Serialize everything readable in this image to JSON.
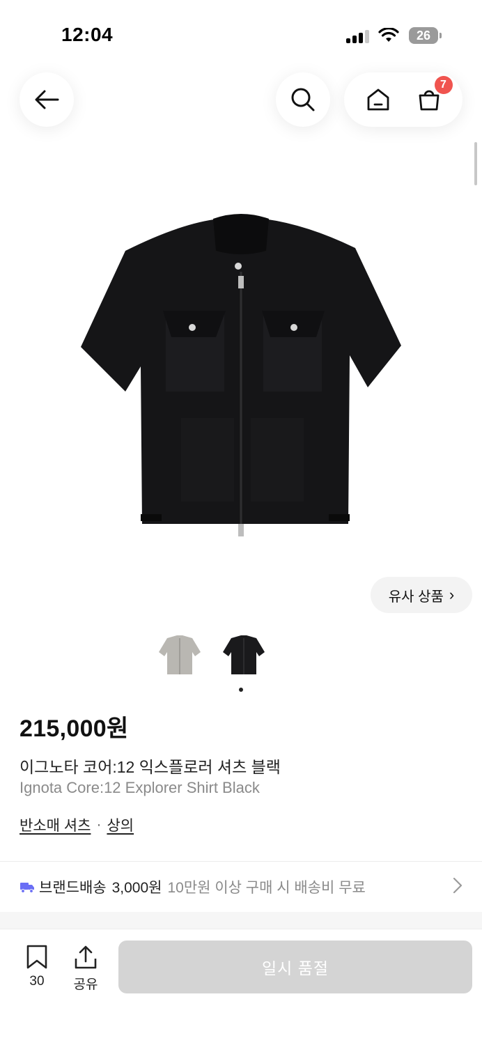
{
  "status_bar": {
    "time": "12:04",
    "battery": "26"
  },
  "nav": {
    "cart_count": "7"
  },
  "product": {
    "price": "215,000원",
    "name_ko": "이그노타 코어:12 익스플로러 셔츠 블랙",
    "name_en": "Ignota Core:12 Explorer Shirt Black",
    "category_1": "반소매 셔츠",
    "category_sep": "·",
    "category_2": "상의",
    "thumbnail_colors": [
      "#b9b7b2",
      "#1a1a1c"
    ],
    "active_thumbnail_index": 1
  },
  "similar_button": {
    "label": "유사 상품",
    "chevron": "›"
  },
  "shipping": {
    "title": "브랜드배송",
    "fee": "3,000원",
    "note": "10만원 이상 구매 시 배송비 무료",
    "icon": "truck-icon",
    "icon_color": "#6a6ef5"
  },
  "bottom_bar": {
    "bookmark_count": "30",
    "share_label": "공유",
    "cta_label": "일시 품절"
  },
  "colors": {
    "badge": "#f0544f",
    "cta_disabled": "#d4d4d4",
    "muted_text": "#8a8a8a"
  }
}
